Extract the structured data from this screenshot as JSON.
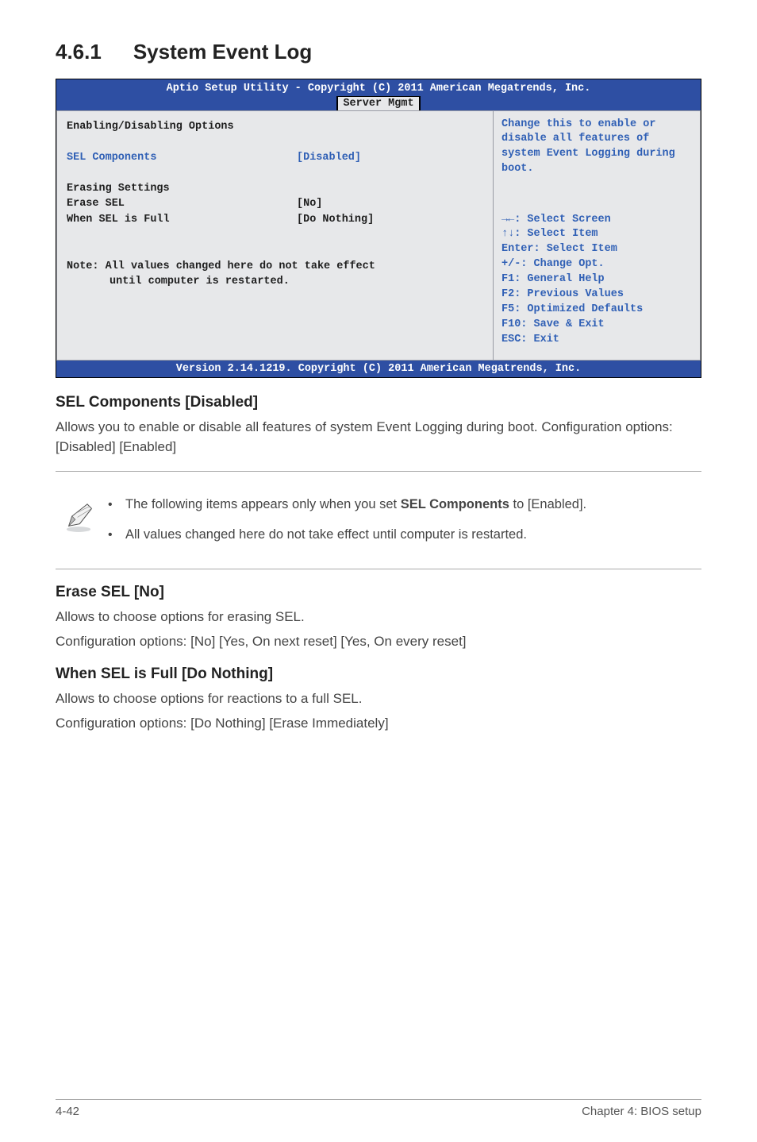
{
  "section": {
    "number": "4.6.1",
    "title": "System Event Log"
  },
  "bios": {
    "header_line": "Aptio Setup Utility - Copyright (C) 2011 American Megatrends, Inc.",
    "tab": "Server Mgmt",
    "left": {
      "heading": "Enabling/Disabling Options",
      "sel_label": "SEL Components",
      "sel_value": "[Disabled]",
      "erase_heading": "Erasing Settings",
      "erase_label": "Erase SEL",
      "erase_value": "[No]",
      "full_label": "When SEL is Full",
      "full_value": "[Do Nothing]",
      "note_l1": "Note: All values changed here do not take effect",
      "note_l2": "until computer is restarted."
    },
    "right": {
      "help": "Change this to enable or disable all features of system Event Logging during boot.",
      "k1": "→←: Select Screen",
      "k2": "↑↓:  Select Item",
      "k3": "Enter: Select Item",
      "k4": "+/-: Change Opt.",
      "k5": "F1: General Help",
      "k6": "F2: Previous Values",
      "k7": "F5: Optimized Defaults",
      "k8": "F10: Save & Exit",
      "k9": "ESC: Exit"
    },
    "footer": "Version 2.14.1219. Copyright (C) 2011 American Megatrends, Inc."
  },
  "body": {
    "h1": "SEL Components [Disabled]",
    "p1": "Allows you to enable or disable all features of system Event Logging during boot. Configuration options: [Disabled] [Enabled]",
    "note1_pre": "The following items appears only when you set ",
    "note1_bold": "SEL Components",
    "note1_post": " to [Enabled].",
    "note2": "All values changed here do not take effect until computer is restarted.",
    "h2": "Erase SEL [No]",
    "p2a": "Allows to choose options for erasing SEL.",
    "p2b": "Configuration options: [No] [Yes, On next reset] [Yes, On every reset]",
    "h3": "When SEL is Full [Do Nothing]",
    "p3a": "Allows to choose options for reactions to a full SEL.",
    "p3b": "Configuration options: [Do Nothing] [Erase Immediately]"
  },
  "footer": {
    "left": "4-42",
    "right": "Chapter 4: BIOS setup"
  }
}
